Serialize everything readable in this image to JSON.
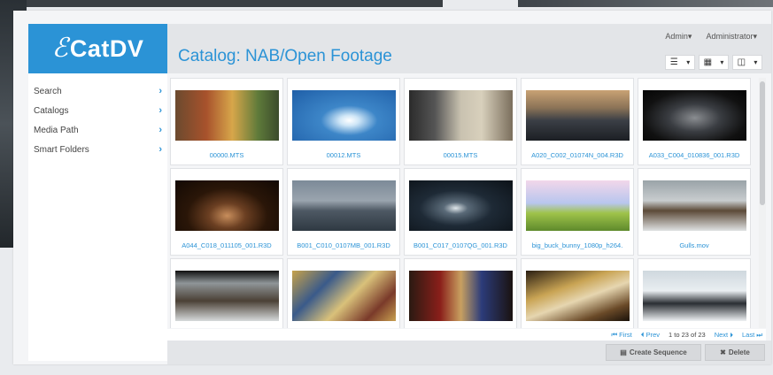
{
  "app": {
    "logo_mark": "ℰ",
    "logo_text": "CatDV"
  },
  "header": {
    "title": "Catalog: NAB/Open Footage",
    "menus": [
      {
        "label": "Admin",
        "caret": "▾"
      },
      {
        "label": "Administrator",
        "caret": "▾"
      }
    ],
    "view_buttons": [
      {
        "icon": "list-icon",
        "glyph": "☰",
        "caret": "▾"
      },
      {
        "icon": "grid-icon",
        "glyph": "▦",
        "caret": "▾"
      },
      {
        "icon": "panel-icon",
        "glyph": "◫",
        "caret": "▾"
      }
    ]
  },
  "sidebar": {
    "chevron": "›",
    "items": [
      {
        "label": "Search"
      },
      {
        "label": "Catalogs"
      },
      {
        "label": "Media Path"
      },
      {
        "label": "Smart Folders"
      }
    ]
  },
  "clips": [
    {
      "name": "00000.MTS"
    },
    {
      "name": "00012.MTS"
    },
    {
      "name": "00015.MTS"
    },
    {
      "name": "A020_C002_01074N_004.R3D"
    },
    {
      "name": "A033_C004_010836_001.R3D"
    },
    {
      "name": "A044_C018_011105_001.R3D"
    },
    {
      "name": "B001_C010_0107MB_001.R3D"
    },
    {
      "name": "B001_C017_0107QG_001.R3D"
    },
    {
      "name": "big_buck_bunny_1080p_h264."
    },
    {
      "name": "Gulls.mov"
    },
    {
      "name": ""
    },
    {
      "name": ""
    },
    {
      "name": ""
    },
    {
      "name": ""
    },
    {
      "name": ""
    }
  ],
  "pager": {
    "first": "⏮ First",
    "prev": "⏴ Prev",
    "range": "1 to 23 of 23",
    "next": "Next ⏵",
    "last": "Last ⏭"
  },
  "actions": {
    "create": {
      "icon": "▤",
      "label": "Create Sequence"
    },
    "delete": {
      "icon": "✖",
      "label": "Delete"
    }
  },
  "colors": {
    "accent": "#2b93d6",
    "background": "#f4f5f7",
    "bar": "#e3e5e8"
  }
}
